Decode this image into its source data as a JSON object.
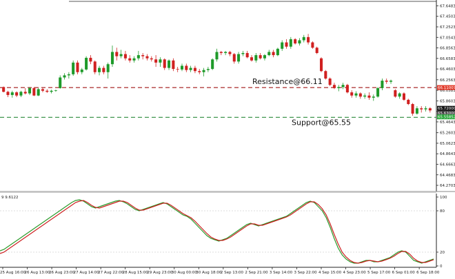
{
  "chart_data": [
    {
      "type": "candlestick",
      "price_axis": {
        "ylim": [
          64.18,
          67.68
        ],
        "tick_labels": [
          "67.64830",
          "67.45030",
          "67.25230",
          "67.05430",
          "66.85630",
          "66.65830",
          "66.46030",
          "66.25630",
          "66.05830",
          "65.86030",
          "65.66230",
          "65.46430",
          "65.26030",
          "65.06230",
          "64.86430",
          "64.66630",
          "64.46830",
          "64.27030"
        ],
        "tick_values": [
          67.6483,
          67.4503,
          67.2523,
          67.0543,
          66.8563,
          66.6583,
          66.4603,
          66.2563,
          66.0583,
          65.8603,
          65.6623,
          65.4643,
          65.2603,
          65.0623,
          64.8643,
          64.6663,
          64.4683,
          64.2703
        ]
      },
      "candles": [
        [
          66.12,
          66.13,
          66.02,
          66.03
        ],
        [
          66.03,
          66.05,
          65.93,
          65.97
        ],
        [
          65.97,
          66.05,
          65.92,
          66.02
        ],
        [
          66.02,
          66.04,
          65.93,
          65.96
        ],
        [
          65.96,
          66.05,
          65.93,
          66.03
        ],
        [
          66.03,
          66.1,
          65.98,
          66.0
        ],
        [
          66.0,
          66.12,
          65.97,
          66.1
        ],
        [
          66.1,
          66.12,
          65.95,
          65.96
        ],
        [
          65.96,
          66.1,
          65.95,
          66.08
        ],
        [
          66.08,
          66.1,
          66.02,
          66.05
        ],
        [
          66.05,
          66.08,
          66.01,
          66.03
        ],
        [
          66.03,
          66.07,
          66.0,
          66.05
        ],
        [
          66.05,
          66.07,
          66.03,
          66.06
        ],
        [
          66.1,
          66.34,
          66.09,
          66.3
        ],
        [
          66.3,
          66.38,
          66.26,
          66.34
        ],
        [
          66.34,
          66.4,
          66.28,
          66.36
        ],
        [
          66.36,
          66.62,
          66.33,
          66.58
        ],
        [
          66.58,
          66.62,
          66.36,
          66.4
        ],
        [
          66.4,
          66.48,
          66.36,
          66.45
        ],
        [
          66.45,
          66.7,
          66.43,
          66.67
        ],
        [
          66.67,
          66.72,
          66.55,
          66.6
        ],
        [
          66.6,
          66.62,
          66.36,
          66.4
        ],
        [
          66.4,
          66.52,
          66.34,
          66.48
        ],
        [
          66.48,
          66.52,
          66.36,
          66.4
        ],
        [
          66.4,
          66.58,
          66.28,
          66.55
        ],
        [
          66.55,
          66.9,
          66.5,
          66.78
        ],
        [
          66.78,
          66.86,
          66.62,
          66.7
        ],
        [
          66.7,
          66.82,
          66.66,
          66.74
        ],
        [
          66.74,
          66.8,
          66.62,
          66.66
        ],
        [
          66.66,
          66.72,
          66.58,
          66.62
        ],
        [
          66.62,
          66.7,
          66.58,
          66.66
        ],
        [
          66.66,
          66.8,
          66.62,
          66.72
        ],
        [
          66.72,
          66.76,
          66.64,
          66.7
        ],
        [
          66.7,
          66.74,
          66.62,
          66.66
        ],
        [
          66.66,
          66.7,
          66.6,
          66.64
        ],
        [
          66.64,
          66.72,
          66.5,
          66.58
        ],
        [
          66.58,
          66.68,
          66.5,
          66.64
        ],
        [
          66.64,
          66.66,
          66.44,
          66.48
        ],
        [
          66.48,
          66.64,
          66.44,
          66.62
        ],
        [
          66.62,
          66.66,
          66.42,
          66.46
        ],
        [
          66.46,
          66.5,
          66.4,
          66.45
        ],
        [
          66.45,
          66.56,
          66.42,
          66.52
        ],
        [
          66.52,
          66.56,
          66.4,
          66.44
        ],
        [
          66.44,
          66.52,
          66.4,
          66.48
        ],
        [
          66.48,
          66.52,
          66.38,
          66.42
        ],
        [
          66.42,
          66.46,
          66.36,
          66.4
        ],
        [
          66.4,
          66.48,
          66.32,
          66.44
        ],
        [
          66.44,
          66.5,
          66.4,
          66.46
        ],
        [
          66.46,
          66.66,
          66.44,
          66.64
        ],
        [
          66.64,
          66.84,
          66.6,
          66.78
        ],
        [
          66.78,
          66.8,
          66.72,
          66.76
        ],
        [
          66.76,
          66.8,
          66.72,
          66.78
        ],
        [
          66.78,
          66.8,
          66.7,
          66.74
        ],
        [
          66.74,
          66.76,
          66.56,
          66.6
        ],
        [
          66.6,
          66.78,
          66.56,
          66.74
        ],
        [
          66.74,
          66.8,
          66.7,
          66.76
        ],
        [
          66.76,
          66.8,
          66.66,
          66.68
        ],
        [
          66.68,
          66.72,
          66.6,
          66.62
        ],
        [
          66.62,
          66.76,
          66.58,
          66.72
        ],
        [
          66.72,
          66.76,
          66.64,
          66.66
        ],
        [
          66.66,
          66.74,
          66.62,
          66.72
        ],
        [
          66.72,
          66.82,
          66.7,
          66.78
        ],
        [
          66.78,
          66.82,
          66.68,
          66.72
        ],
        [
          66.72,
          66.86,
          66.7,
          66.84
        ],
        [
          66.84,
          67.0,
          66.8,
          66.96
        ],
        [
          66.96,
          67.02,
          66.84,
          66.88
        ],
        [
          66.88,
          67.06,
          66.84,
          67.02
        ],
        [
          67.02,
          67.04,
          66.92,
          66.94
        ],
        [
          66.94,
          67.04,
          66.9,
          67.0
        ],
        [
          67.0,
          67.1,
          66.96,
          67.06
        ],
        [
          67.06,
          67.12,
          66.92,
          66.96
        ],
        [
          66.96,
          66.98,
          66.84,
          66.86
        ],
        [
          66.86,
          66.88,
          66.74,
          66.76
        ],
        [
          66.66,
          66.68,
          66.4,
          66.42
        ],
        [
          66.42,
          66.44,
          66.26,
          66.28
        ],
        [
          66.28,
          66.3,
          66.14,
          66.16
        ],
        [
          66.16,
          66.2,
          66.08,
          66.1
        ],
        [
          66.1,
          66.16,
          66.04,
          66.12
        ],
        [
          66.12,
          66.2,
          66.08,
          66.16
        ],
        [
          66.16,
          66.18,
          66.0,
          66.02
        ],
        [
          66.02,
          66.06,
          65.92,
          65.96
        ],
        [
          65.96,
          66.04,
          65.92,
          66.0
        ],
        [
          66.0,
          66.02,
          65.9,
          65.94
        ],
        [
          65.94,
          66.0,
          65.9,
          65.96
        ],
        [
          65.96,
          66.02,
          65.88,
          65.92
        ],
        [
          65.92,
          65.98,
          65.86,
          65.94
        ],
        [
          65.94,
          66.12,
          65.92,
          66.1
        ],
        [
          66.1,
          66.28,
          66.06,
          66.24
        ],
        [
          66.24,
          66.28,
          66.18,
          66.22
        ],
        [
          66.22,
          66.26,
          66.18,
          66.24
        ],
        [
          66.06,
          66.08,
          65.92,
          65.94
        ],
        [
          65.94,
          66.02,
          65.9,
          66.0
        ],
        [
          66.0,
          66.02,
          65.86,
          65.88
        ],
        [
          65.88,
          65.9,
          65.78,
          65.8
        ],
        [
          65.8,
          65.82,
          65.58,
          65.62
        ],
        [
          65.62,
          65.76,
          65.6,
          65.72
        ],
        [
          65.72,
          65.76,
          65.64,
          65.7
        ],
        [
          65.7,
          65.76,
          65.66,
          65.72
        ],
        [
          65.72,
          65.74,
          65.64,
          65.68
        ]
      ],
      "current_price_label": "65.72000",
      "price_tags": [
        {
          "label": "66.11007",
          "value": 66.11007,
          "color": "#e23a2a"
        },
        {
          "label": "65.63000",
          "value": 65.63,
          "color": "#3a3a3a"
        },
        {
          "label": "65.55852",
          "value": 65.55852,
          "color": "#2aa63a"
        }
      ],
      "lines": [
        {
          "name": "resistance",
          "value": 66.11,
          "label": "Resistance@66.11",
          "color": "#a82a2a",
          "style": "dashed"
        },
        {
          "name": "support",
          "value": 65.55,
          "label": "Support@65.55",
          "color": "#2a8a3a",
          "style": "dashed"
        }
      ]
    },
    {
      "type": "line",
      "indicator_label": "9 9.6122",
      "ylim": [
        0,
        100
      ],
      "tick_labels": [
        "100",
        "80",
        "20",
        "0"
      ],
      "tick_values": [
        100,
        80,
        20,
        0
      ],
      "levels": [
        80,
        20
      ],
      "series": [
        {
          "color": "#2a9a2a",
          "values": [
            22,
            24,
            28,
            32,
            36,
            40,
            44,
            48,
            52,
            56,
            60,
            64,
            68,
            72,
            76,
            80,
            84,
            88,
            92,
            95,
            96,
            94,
            90,
            86,
            84,
            86,
            88,
            90,
            92,
            94,
            95,
            93,
            90,
            86,
            82,
            80,
            82,
            84,
            86,
            88,
            90,
            92,
            90,
            86,
            82,
            78,
            74,
            72,
            68,
            62,
            56,
            50,
            44,
            40,
            38,
            36,
            38,
            40,
            44,
            48,
            52,
            56,
            60,
            62,
            60,
            58,
            60,
            62,
            64,
            66,
            68,
            70,
            72,
            76,
            80,
            84,
            88,
            92,
            94,
            92,
            86,
            80,
            70,
            56,
            40,
            26,
            16,
            10,
            6,
            4,
            4,
            6,
            8,
            8,
            6,
            6,
            8,
            10,
            12,
            16,
            20,
            22,
            20,
            14,
            8,
            6,
            4,
            6,
            8,
            10
          ]
        },
        {
          "color": "#cc2020",
          "values": [
            18,
            20,
            24,
            28,
            32,
            36,
            40,
            44,
            48,
            52,
            56,
            60,
            64,
            68,
            72,
            76,
            80,
            84,
            88,
            92,
            94,
            95,
            92,
            88,
            85,
            84,
            86,
            88,
            90,
            92,
            94,
            94,
            92,
            88,
            84,
            81,
            81,
            83,
            85,
            87,
            89,
            91,
            91,
            88,
            84,
            80,
            76,
            73,
            70,
            65,
            59,
            53,
            47,
            42,
            39,
            37,
            37,
            39,
            42,
            46,
            50,
            54,
            58,
            61,
            61,
            59,
            59,
            61,
            63,
            65,
            67,
            69,
            71,
            74,
            78,
            82,
            86,
            90,
            93,
            93,
            89,
            83,
            74,
            61,
            46,
            32,
            20,
            13,
            8,
            5,
            4,
            5,
            7,
            8,
            7,
            6,
            7,
            9,
            11,
            14,
            18,
            21,
            21,
            17,
            11,
            7,
            5,
            5,
            7,
            9
          ]
        }
      ]
    }
  ],
  "time_axis": {
    "labels": [
      "25 Aug 16:00",
      "26 Aug 13:00",
      "26 Aug 23:00",
      "27 Aug 14:00",
      "27 Aug 22:00",
      "28 Aug 15:00",
      "29 Aug 23:00",
      "30 Aug 00:00",
      "30 Aug 18:00",
      "2 Sep 13:00",
      "2 Sep 21:00",
      "3 Sep 14:00",
      "3 Sep 22:00",
      "4 Sep 15:00",
      "4 Sep 23:00",
      "5 Sep 17:00",
      "6 Sep 01:00",
      "6 Sep 18:00"
    ]
  }
}
